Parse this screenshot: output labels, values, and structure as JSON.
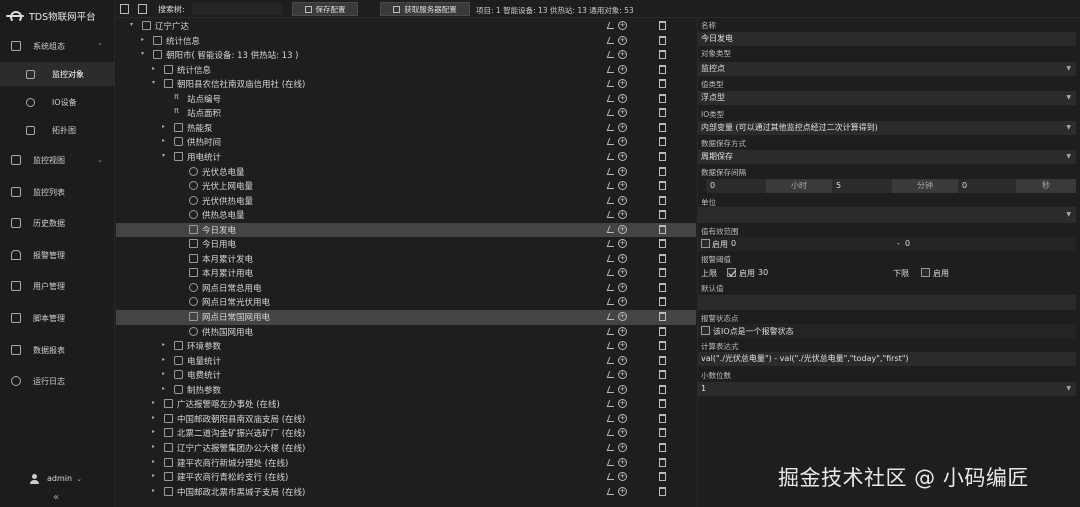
{
  "app": {
    "title": "TDS物联网平台"
  },
  "sidebar": {
    "items": [
      {
        "label": "系统组态",
        "icon": "network-icon",
        "expanded": true
      },
      {
        "label": "监控对象",
        "icon": "edit-box-icon",
        "sub": true,
        "active": true
      },
      {
        "label": "IO设备",
        "icon": "device-icon",
        "sub": true
      },
      {
        "label": "拓扑图",
        "icon": "topology-icon",
        "sub": true
      },
      {
        "label": "监控视图",
        "icon": "monitor-icon",
        "expandable": true
      },
      {
        "label": "监控列表",
        "icon": "list-icon"
      },
      {
        "label": "历史数据",
        "icon": "chart-line-icon"
      },
      {
        "label": "报警管理",
        "icon": "bell-icon"
      },
      {
        "label": "用户管理",
        "icon": "users-icon"
      },
      {
        "label": "脚本管理",
        "icon": "script-icon"
      },
      {
        "label": "数据报表",
        "icon": "book-icon"
      },
      {
        "label": "运行日志",
        "icon": "log-icon"
      }
    ],
    "user": "admin",
    "collapse_symbol": "«"
  },
  "toolbar": {
    "search_label": "搜索树:",
    "search_value": "",
    "save_config": "保存配置",
    "fetch_server_config": "获取服务器配置",
    "stats": "项目: 1    智能设备: 13    供热站: 13    通用对象: 53"
  },
  "tree": [
    {
      "d": 0,
      "arrow": "▾",
      "icon": "building",
      "text": "辽宁广达"
    },
    {
      "d": 1,
      "arrow": "▸",
      "icon": "grid",
      "text": "统计信息"
    },
    {
      "d": 1,
      "arrow": "▾",
      "icon": "building",
      "text": "朝阳市( 智能设备: 13   供热站: 13   )"
    },
    {
      "d": 2,
      "arrow": "▸",
      "icon": "grid",
      "text": "统计信息"
    },
    {
      "d": 2,
      "arrow": "▾",
      "icon": "grid",
      "text": "朝阳县农信社南双庙信用社 (在线)"
    },
    {
      "d": 3,
      "arrow": "",
      "icon": "pi",
      "text": "站点编号"
    },
    {
      "d": 3,
      "arrow": "",
      "icon": "pi",
      "text": "站点面积"
    },
    {
      "d": 3,
      "arrow": "▸",
      "icon": "grid",
      "text": "热能泵"
    },
    {
      "d": 3,
      "arrow": "▸",
      "icon": "cube",
      "text": "供热时间"
    },
    {
      "d": 3,
      "arrow": "▾",
      "icon": "grid",
      "text": "用电统计"
    },
    {
      "d": 4,
      "arrow": "",
      "icon": "gauge",
      "text": "光伏总电量"
    },
    {
      "d": 4,
      "arrow": "",
      "icon": "gauge",
      "text": "光伏上网电量"
    },
    {
      "d": 4,
      "arrow": "",
      "icon": "gauge",
      "text": "光伏供热电量"
    },
    {
      "d": 4,
      "arrow": "",
      "icon": "gauge",
      "text": "供热总电量"
    },
    {
      "d": 4,
      "arrow": "",
      "icon": "calc",
      "text": "今日发电",
      "selected": true
    },
    {
      "d": 4,
      "arrow": "",
      "icon": "calc",
      "text": "今日用电"
    },
    {
      "d": 4,
      "arrow": "",
      "icon": "calc",
      "text": "本月累计发电"
    },
    {
      "d": 4,
      "arrow": "",
      "icon": "calc",
      "text": "本月累计用电"
    },
    {
      "d": 4,
      "arrow": "",
      "icon": "gauge",
      "text": "网点日常总用电"
    },
    {
      "d": 4,
      "arrow": "",
      "icon": "gauge",
      "text": "网点日常光伏用电"
    },
    {
      "d": 4,
      "arrow": "",
      "icon": "calc",
      "text": "网点日常国网用电",
      "hover": true
    },
    {
      "d": 4,
      "arrow": "",
      "icon": "gauge",
      "text": "供热国网用电"
    },
    {
      "d": 3,
      "arrow": "▸",
      "icon": "grid",
      "text": "环境参数"
    },
    {
      "d": 3,
      "arrow": "▸",
      "icon": "cube",
      "text": "电量统计"
    },
    {
      "d": 3,
      "arrow": "▸",
      "icon": "cube",
      "text": "电费统计"
    },
    {
      "d": 3,
      "arrow": "▸",
      "icon": "cube",
      "text": "制热参数"
    },
    {
      "d": 2,
      "arrow": "▸",
      "icon": "grid",
      "text": "广达报警喀左办事处 (在线)"
    },
    {
      "d": 2,
      "arrow": "▸",
      "icon": "grid",
      "text": "中国邮政朝阳县南双庙支局 (在线)"
    },
    {
      "d": 2,
      "arrow": "▸",
      "icon": "grid",
      "text": "北票二道沟金矿振兴选矿厂 (在线)"
    },
    {
      "d": 2,
      "arrow": "▸",
      "icon": "grid",
      "text": "辽宁广达报警集团办公大楼 (在线)"
    },
    {
      "d": 2,
      "arrow": "▸",
      "icon": "grid",
      "text": "建平农商行新城分理处 (在线)"
    },
    {
      "d": 2,
      "arrow": "▸",
      "icon": "grid",
      "text": "建平农商行青松岭支行 (在线)"
    },
    {
      "d": 2,
      "arrow": "▸",
      "icon": "grid",
      "text": "中国邮政北票市黑城子支局 (在线)"
    }
  ],
  "panel": {
    "name_label": "名称",
    "name_value": "今日发电",
    "obj_type_label": "对象类型",
    "obj_type_value": "监控点",
    "value_type_label": "值类型",
    "value_type_value": "浮点型",
    "io_type_label": "IO类型",
    "io_type_value": "内部变量 (可以通过其他监控点经过二次计算得到)",
    "save_mode_label": "数据保存方式",
    "save_mode_value": "周期保存",
    "save_interval_label": "数据保存间隔",
    "interval_hours": "0",
    "interval_hours_unit": "小时",
    "interval_minutes": "5",
    "interval_minutes_unit": "分钟",
    "interval_seconds": "0",
    "interval_seconds_unit": "秒",
    "unit_label": "单位",
    "unit_value": "",
    "valid_range_label": "值有效范围",
    "valid_enable": "启用",
    "valid_min": "0",
    "valid_sep": "-",
    "valid_max": "0",
    "alarm_threshold_label": "报警阈值",
    "alarm_upper_label": "上限",
    "alarm_upper_enable": "启用",
    "alarm_upper_value": "30",
    "alarm_lower_label": "下限",
    "alarm_lower_enable": "启用",
    "default_label": "默认值",
    "default_value": "",
    "alarm_state_label": "报警状态点",
    "alarm_state_text": "该IO点是一个报警状态",
    "expr_label": "计算表达式",
    "expr_value": "val(\"./光伏总电量\") - val(\"./光伏总电量\",\"today\",\"first\")",
    "decimals_label": "小数位数",
    "decimals_value": "1"
  },
  "watermark": "掘金技术社区 @ 小码编匠"
}
